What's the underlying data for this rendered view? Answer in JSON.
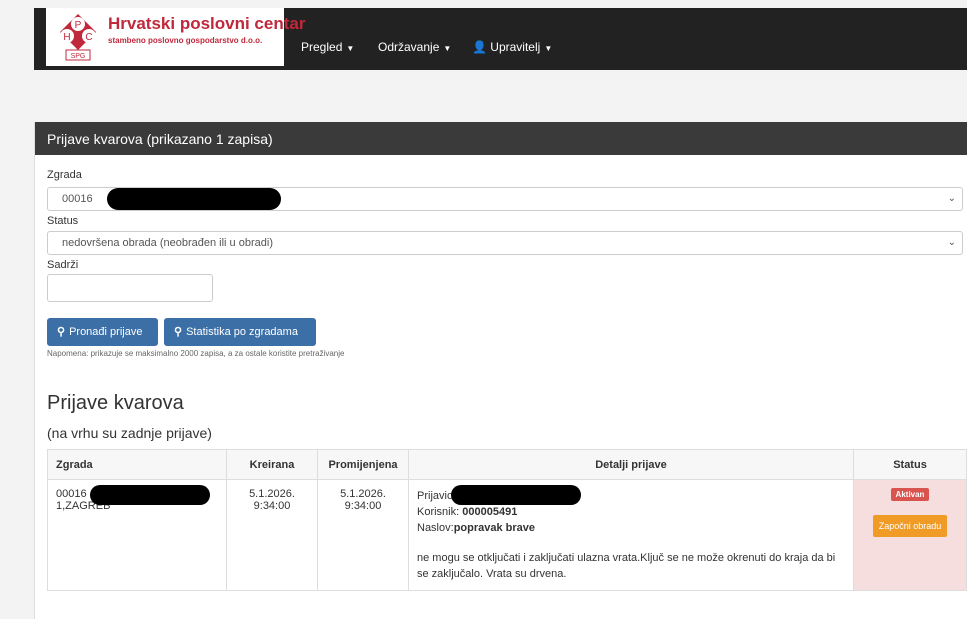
{
  "brand": {
    "title": "Hrvatski poslovni centar",
    "subtitle": "stambeno poslovno gospodarstvo d.o.o.",
    "logo_letters": [
      "H",
      "P",
      "C",
      "SPG"
    ]
  },
  "nav": {
    "pregled": "Pregled",
    "odrzavanje": "Održavanje",
    "upravitelj": "Upravitelj"
  },
  "panel": {
    "heading": "Prijave kvarova (prikazano 1 zapisa)"
  },
  "filters": {
    "zgrada_label": "Zgrada",
    "zgrada_value": "00016",
    "status_label": "Status",
    "status_value": "nedovršena obrada (neobrađen ili u obradi)",
    "sadrzi_label": "Sadrži",
    "sadrzi_value": ""
  },
  "buttons": {
    "pronadi": "Pronađi prijave",
    "statistika": "Statistika po zgradama"
  },
  "note": "Napomena: prikazuje se maksimalno 2000 zapisa, a za ostale koristite pretraživanje",
  "section": {
    "title": "Prijave kvarova",
    "subtitle": "(na vrhu su zadnje prijave)"
  },
  "table": {
    "headers": [
      "Zgrada",
      "Kreirana",
      "Promijenjena",
      "Detalji prijave",
      "Status"
    ],
    "rows": [
      {
        "zgrada_code": "00016",
        "zgrada_city": "1,ZAGREB",
        "kreirana_date": "5.1.2026.",
        "kreirana_time": "9:34:00",
        "promijenjena_date": "5.1.2026.",
        "promijenjena_time": "9:34:00",
        "prijavio_label": "Prijavio",
        "korisnik_label": "Korisnik: ",
        "korisnik_value": "000005491",
        "naslov_label": "Naslov:",
        "naslov_value": "popravak brave",
        "opis": "ne mogu se otključati i zaključati ulazna vrata.Ključ se ne može okrenuti do kraja da bi se zaključalo. Vrata su drvena.",
        "status_badge": "Aktivan",
        "action": "Započni obradu"
      }
    ]
  },
  "colors": {
    "navbar": "#222222",
    "brand_red": "#c0283b",
    "primary_button": "#3b6fa6",
    "badge_danger": "#d9534f",
    "warning_button": "#ef9b26",
    "status_cell": "#f7dede"
  }
}
